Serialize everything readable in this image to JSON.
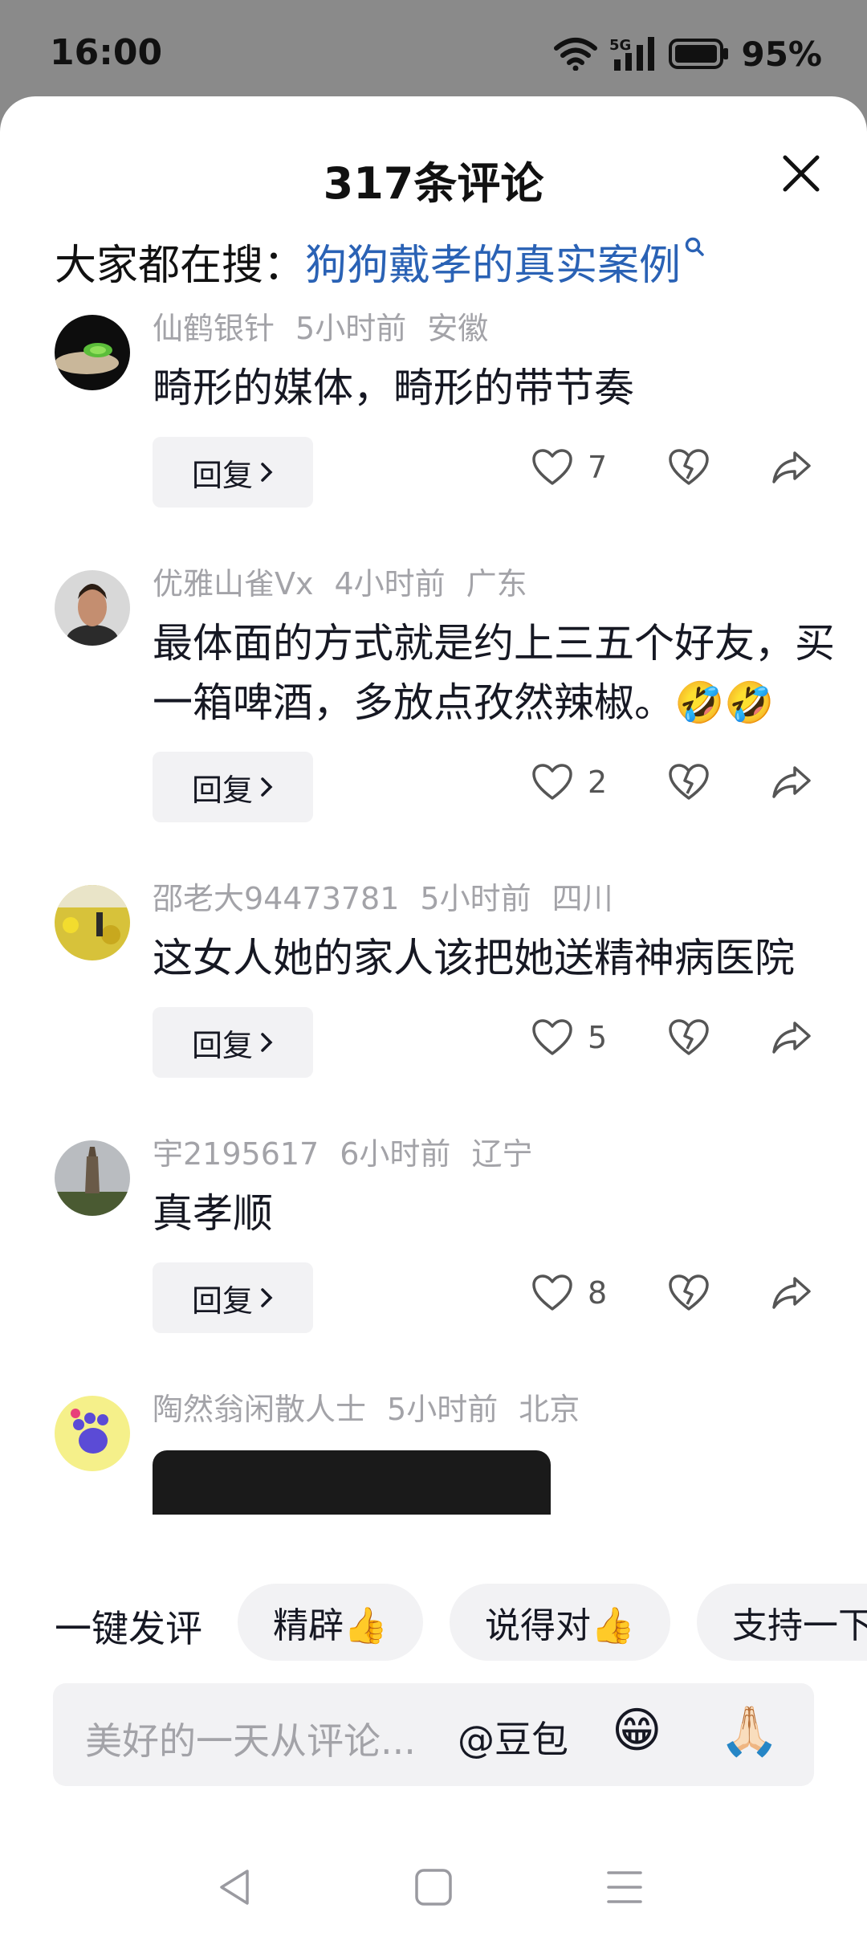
{
  "status_bar": {
    "time": "16:00",
    "network": "5G",
    "battery": "95%"
  },
  "sheet": {
    "title": "317条评论",
    "close_icon": "close-icon"
  },
  "search_hint": {
    "prefix": "大家都在搜：",
    "keyword": "狗狗戴孝的真实案例"
  },
  "comments": [
    {
      "username": "仙鹤银针",
      "time": "5小时前",
      "location": "安徽",
      "text": "畸形的媒体，畸形的带节奏",
      "reply_label": "回复",
      "likes": "7",
      "avatar_icon": "cicada-avatar"
    },
    {
      "username": "优雅山雀Vx",
      "time": "4小时前",
      "location": "广东",
      "text": "最体面的方式就是约上三五个好友，买一箱啤酒，多放点孜然辣椒。🤣🤣",
      "reply_label": "回复",
      "likes": "2",
      "avatar_icon": "man-avatar"
    },
    {
      "username": "邵老大94473781",
      "time": "5小时前",
      "location": "四川",
      "text": "这女人她的家人该把她送精神病医院",
      "reply_label": "回复",
      "likes": "5",
      "avatar_icon": "rapeseed-field-avatar"
    },
    {
      "username": "宇2195617",
      "time": "6小时前",
      "location": "辽宁",
      "text": "真孝顺",
      "reply_label": "回复",
      "likes": "8",
      "avatar_icon": "pagoda-avatar"
    },
    {
      "username": "陶然翁闲散人士",
      "time": "5小时前",
      "location": "北京",
      "avatar_icon": "paw-avatar"
    }
  ],
  "quick_comment": {
    "label": "一键发评",
    "chips": [
      "精辟👍",
      "说得对👍",
      "支持一下"
    ]
  },
  "input_bar": {
    "placeholder": "美好的一天从评论...",
    "mention": "@豆包",
    "emoji_1": "😁",
    "emoji_2": "🙏🏻"
  },
  "nav_bar": {
    "back_icon": "back-triangle-icon",
    "home_icon": "home-square-icon",
    "menu_icon": "menu-lines-icon"
  },
  "colors": {
    "link_blue": "#2a62b5",
    "meta_gray": "#a3a3a8",
    "chip_bg": "#f2f2f4"
  }
}
